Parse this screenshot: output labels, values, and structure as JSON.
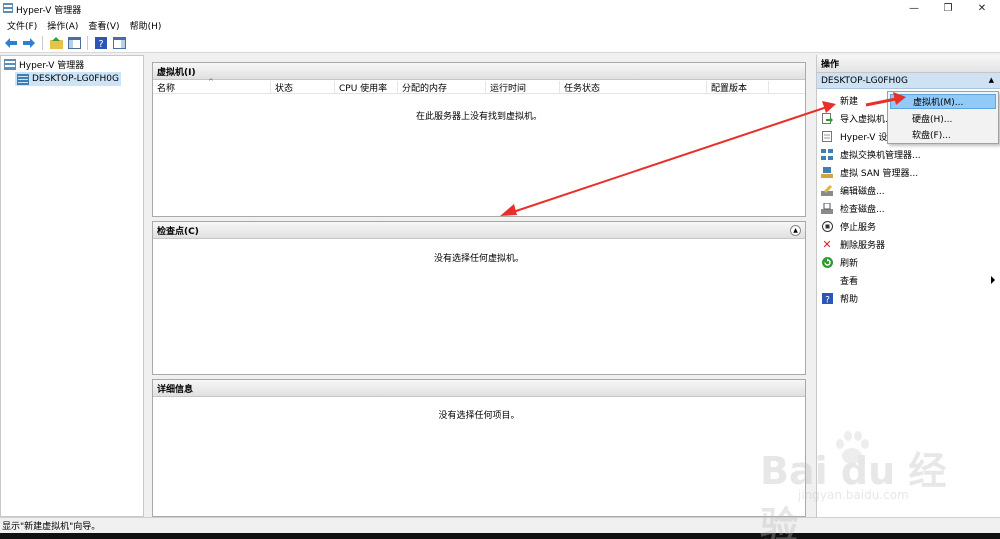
{
  "window": {
    "title": "Hyper-V 管理器",
    "controls": [
      "—",
      "❐",
      "✕"
    ]
  },
  "menubar": {
    "items": [
      "文件(F)",
      "操作(A)",
      "查看(V)",
      "帮助(H)"
    ]
  },
  "toolbar": {
    "icons": [
      "back-icon",
      "forward-icon",
      "up-folder-icon",
      "show-hide-tree-icon",
      "help-icon",
      "show-hide-action-pane-icon"
    ]
  },
  "tree": {
    "root": "Hyper-V 管理器",
    "host": "DESKTOP-LG0FH0G"
  },
  "vm_pane": {
    "title": "虚拟机(I)",
    "columns": [
      "名称",
      "状态",
      "CPU 使用率",
      "分配的内存",
      "运行时间",
      "任务状态",
      "配置版本"
    ],
    "empty_text": "在此服务器上没有找到虚拟机。"
  },
  "checkpoint_pane": {
    "title": "检查点(C)",
    "empty_text": "没有选择任何虚拟机。"
  },
  "details_pane": {
    "title": "详细信息",
    "empty_text": "没有选择任何项目。"
  },
  "actions": {
    "header": "操作",
    "section": "DESKTOP-LG0FH0G",
    "items": [
      {
        "label": "新建",
        "icon": "new-icon",
        "submenu": true
      },
      {
        "label": "导入虚拟机...",
        "icon": "import-vm-icon"
      },
      {
        "label": "Hyper-V 设置...",
        "icon": "settings-doc-icon"
      },
      {
        "label": "虚拟交换机管理器...",
        "icon": "switch-manager-icon"
      },
      {
        "label": "虚拟 SAN 管理器...",
        "icon": "san-manager-icon"
      },
      {
        "label": "编辑磁盘...",
        "icon": "edit-disk-icon"
      },
      {
        "label": "检查磁盘...",
        "icon": "inspect-disk-icon"
      },
      {
        "label": "停止服务",
        "icon": "stop-service-icon"
      },
      {
        "label": "删除服务器",
        "icon": "remove-server-icon"
      },
      {
        "label": "刷新",
        "icon": "refresh-icon"
      },
      {
        "label": "查看",
        "icon": "",
        "submenu": true
      },
      {
        "label": "帮助",
        "icon": "help-icon"
      }
    ]
  },
  "submenu": {
    "items": [
      "虚拟机(M)...",
      "硬盘(H)...",
      "软盘(F)..."
    ]
  },
  "statusbar": {
    "text": "显示\"新建虚拟机\"向导。"
  },
  "watermark": {
    "main": "Bai du 经验",
    "sub": "jingyan.baidu.com"
  },
  "colors": {
    "selection": "#cce4f7",
    "submenu_highlight": "#91c9f7",
    "annotation_arrow": "#e8302a"
  }
}
